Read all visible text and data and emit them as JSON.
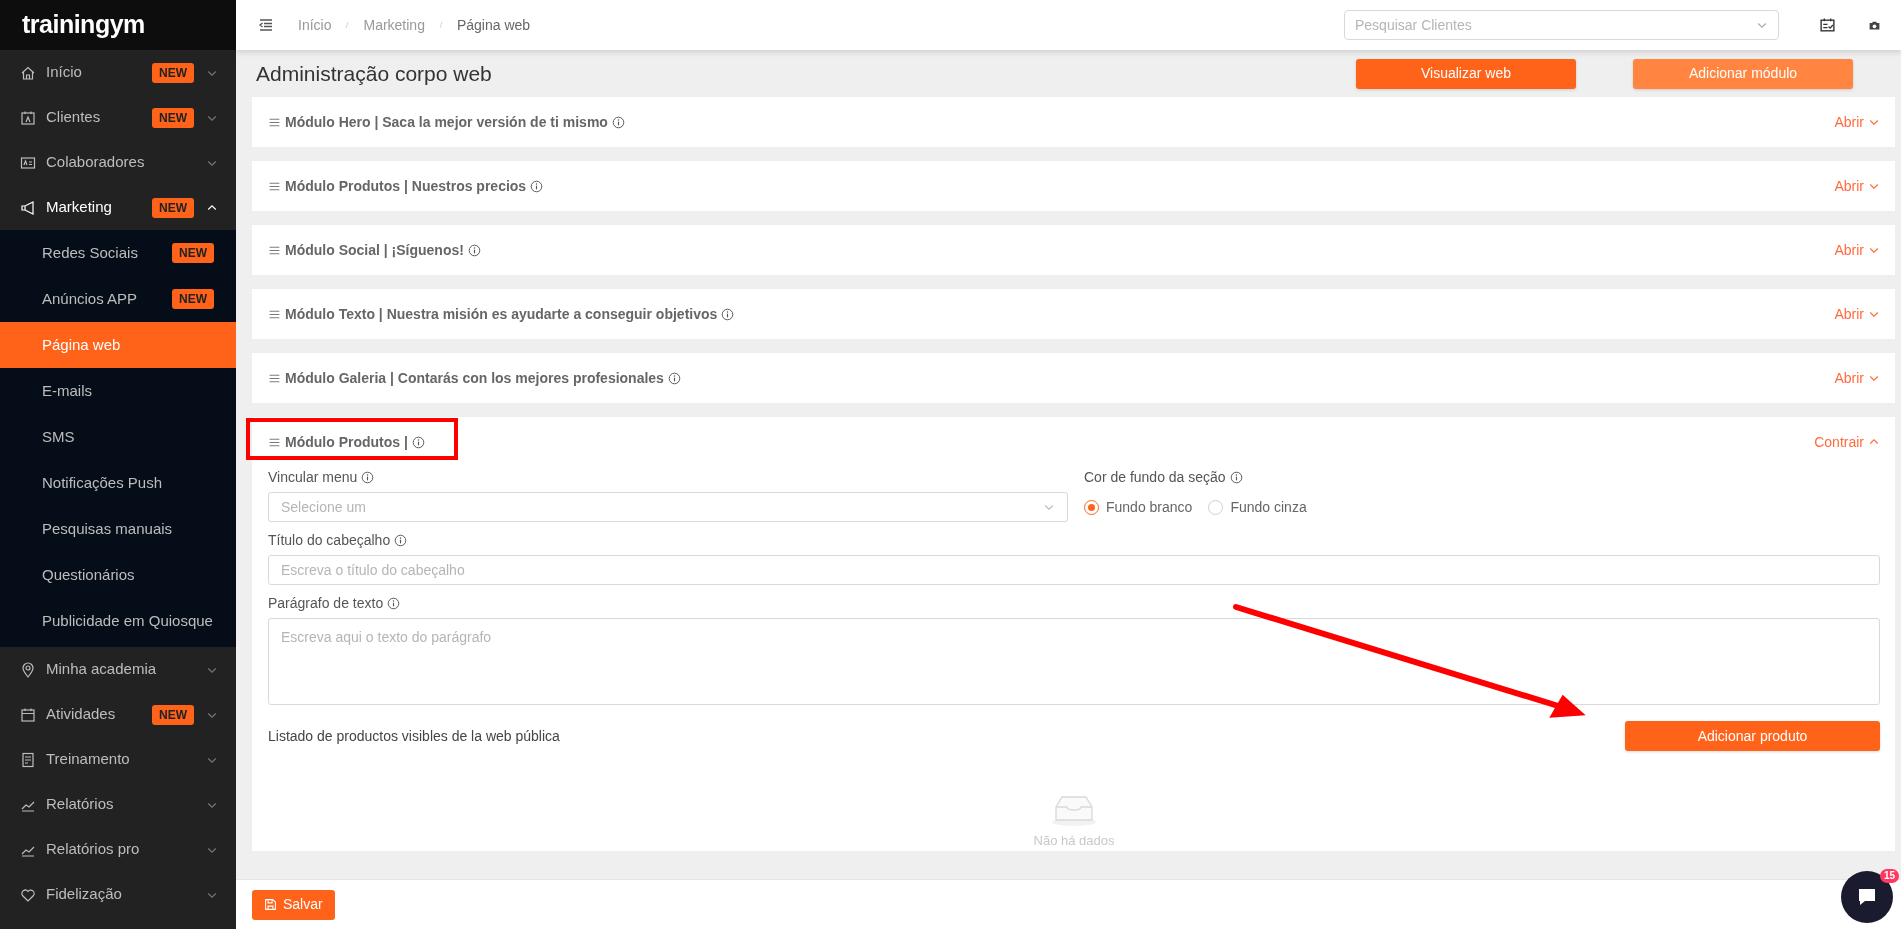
{
  "logo": {
    "text": "trainingym"
  },
  "sidebar": {
    "items": [
      {
        "label": "Início",
        "badge": "NEW",
        "expanded": false
      },
      {
        "label": "Clientes",
        "badge": "NEW",
        "expanded": false
      },
      {
        "label": "Colaboradores",
        "expanded": false
      },
      {
        "label": "Marketing",
        "badge": "NEW",
        "expanded": true,
        "children": [
          {
            "label": "Redes Sociais",
            "badge": "NEW",
            "selected": false
          },
          {
            "label": "Anúncios APP",
            "badge": "NEW",
            "selected": false
          },
          {
            "label": "Página web",
            "selected": true
          },
          {
            "label": "E-mails",
            "selected": false
          },
          {
            "label": "SMS",
            "selected": false
          },
          {
            "label": "Notificações Push",
            "selected": false
          },
          {
            "label": "Pesquisas manuais",
            "selected": false
          },
          {
            "label": "Questionários",
            "selected": false
          },
          {
            "label": "Publicidade em Quiosque",
            "selected": false
          }
        ]
      },
      {
        "label": "Minha academia",
        "expanded": false
      },
      {
        "label": "Atividades",
        "badge": "NEW",
        "expanded": false
      },
      {
        "label": "Treinamento",
        "expanded": false
      },
      {
        "label": "Relatórios",
        "expanded": false
      },
      {
        "label": "Relatórios pro",
        "expanded": false
      },
      {
        "label": "Fidelização",
        "expanded": false
      }
    ]
  },
  "topbar": {
    "breadcrumb": [
      "Início",
      "Marketing",
      "Página web"
    ],
    "search": {
      "placeholder": "Pesquisar Clientes"
    }
  },
  "page": {
    "title": "Administração corpo web",
    "buttons": [
      {
        "label": "Visualizar web",
        "disabled": false
      },
      {
        "label": "Adicionar módulo",
        "disabled": true
      }
    ]
  },
  "modules": [
    {
      "title": "Módulo Hero | Saca la mejor versión de ti mismo",
      "toggle": "Abrir",
      "expanded": false
    },
    {
      "title": "Módulo Produtos | Nuestros precios",
      "toggle": "Abrir",
      "expanded": false
    },
    {
      "title": "Módulo Social | ¡Síguenos!",
      "toggle": "Abrir",
      "expanded": false
    },
    {
      "title": "Módulo Texto | Nuestra misión es ayudarte a conseguir objetivos",
      "toggle": "Abrir",
      "expanded": false
    },
    {
      "title": "Módulo Galeria | Contarás con los mejores profesionales",
      "toggle": "Abrir",
      "expanded": false
    },
    {
      "title": "Módulo Produtos |",
      "toggle": "Contrair",
      "expanded": true,
      "form": {
        "menu": {
          "label": "Vincular menu",
          "placeholder": "Selecione um"
        },
        "background": {
          "label": "Cor de fundo da seção",
          "options": [
            {
              "label": "Fundo branco",
              "selected": true
            },
            {
              "label": "Fundo cinza",
              "selected": false
            }
          ]
        },
        "header_title": {
          "label": "Título do cabeçalho",
          "placeholder": "Escreva o título do cabeçalho"
        },
        "paragraph": {
          "label": "Parágrafo de texto",
          "placeholder": "Escreva aqui o texto do parágrafo"
        },
        "products_label": "Listado de productos visibles de la web pública",
        "add_button": "Adicionar produto",
        "empty_text": "Não há dados"
      }
    }
  ],
  "footer": {
    "save_button": "Salvar"
  },
  "chat": {
    "badge": "15"
  }
}
